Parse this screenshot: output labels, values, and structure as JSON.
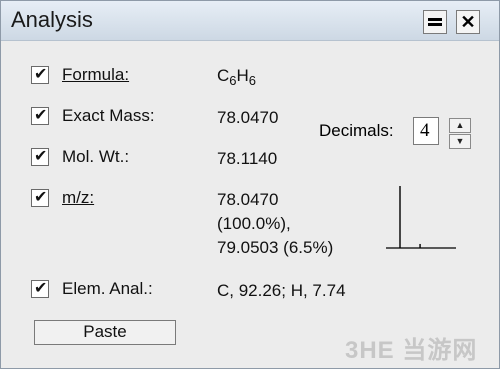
{
  "window": {
    "title": "Analysis",
    "close_glyph": "✕"
  },
  "rows": {
    "formula": {
      "label": "Formula:",
      "value_main": "C",
      "value_sub1": "6",
      "value_mid": "H",
      "value_sub2": "6"
    },
    "exact_mass": {
      "label": "Exact Mass:",
      "value": "78.0470"
    },
    "mol_wt": {
      "label": "Mol. Wt.:",
      "value": "78.1140"
    },
    "mz": {
      "label": "m/z:",
      "line1": "78.0470",
      "line2": "(100.0%),",
      "line3": "79.0503 (6.5%)"
    },
    "elem_anal": {
      "label": "Elem. Anal.:",
      "value": "C, 92.26; H, 7.74"
    }
  },
  "decimals": {
    "label": "Decimals:",
    "value": "4"
  },
  "buttons": {
    "paste": "Paste"
  },
  "watermark": {
    "text": "3HE 当游网"
  },
  "chart_data": {
    "type": "bar",
    "x": [
      78.047,
      79.0503
    ],
    "values": [
      100.0,
      6.5
    ],
    "ylim": [
      0,
      100
    ],
    "title": "",
    "xlabel": "",
    "ylabel": ""
  }
}
